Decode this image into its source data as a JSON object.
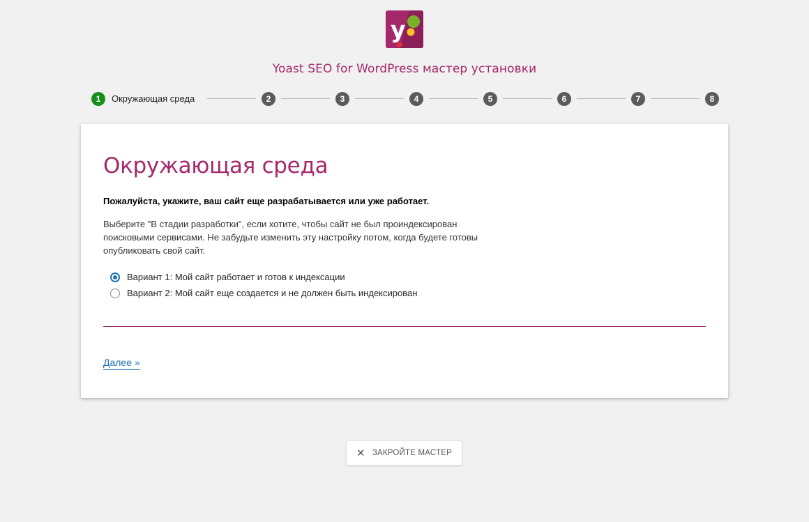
{
  "header": {
    "logo_icon": "yoast-logo-icon",
    "title": "Yoast SEO for WordPress мастер установки"
  },
  "stepper": {
    "active_step": 1,
    "active_color": "#168f1c",
    "inactive_color": "#5b5b5b",
    "steps": [
      {
        "number": "1",
        "label": "Окружающая среда"
      },
      {
        "number": "2"
      },
      {
        "number": "3"
      },
      {
        "number": "4"
      },
      {
        "number": "5"
      },
      {
        "number": "6"
      },
      {
        "number": "7"
      },
      {
        "number": "8"
      }
    ]
  },
  "content": {
    "heading": "Окружающая среда",
    "question": "Пожалуйста, укажите, ваш сайт еще разрабатывается или уже работает.",
    "description": "Выберите \"В стадии разработки\", если хотите, чтобы сайт не был проиндексирован поисковыми сервисами. Не забудьте изменить эту настройку потом, когда будете готовы опубликовать свой сайт.",
    "options": [
      {
        "label": "Вариант 1: Мой сайт работает и готов к индексации",
        "selected": true
      },
      {
        "label": "Вариант 2: Мой сайт еще создается и не должен быть индексирован",
        "selected": false
      }
    ],
    "next_label": "Далее »"
  },
  "footer": {
    "close_icon": "close-icon",
    "close_label": "ЗАКРОЙТЕ МАСТЕР"
  },
  "colors": {
    "brand": "#a4286a",
    "link": "#2271b1",
    "background": "#f1f1f1"
  }
}
